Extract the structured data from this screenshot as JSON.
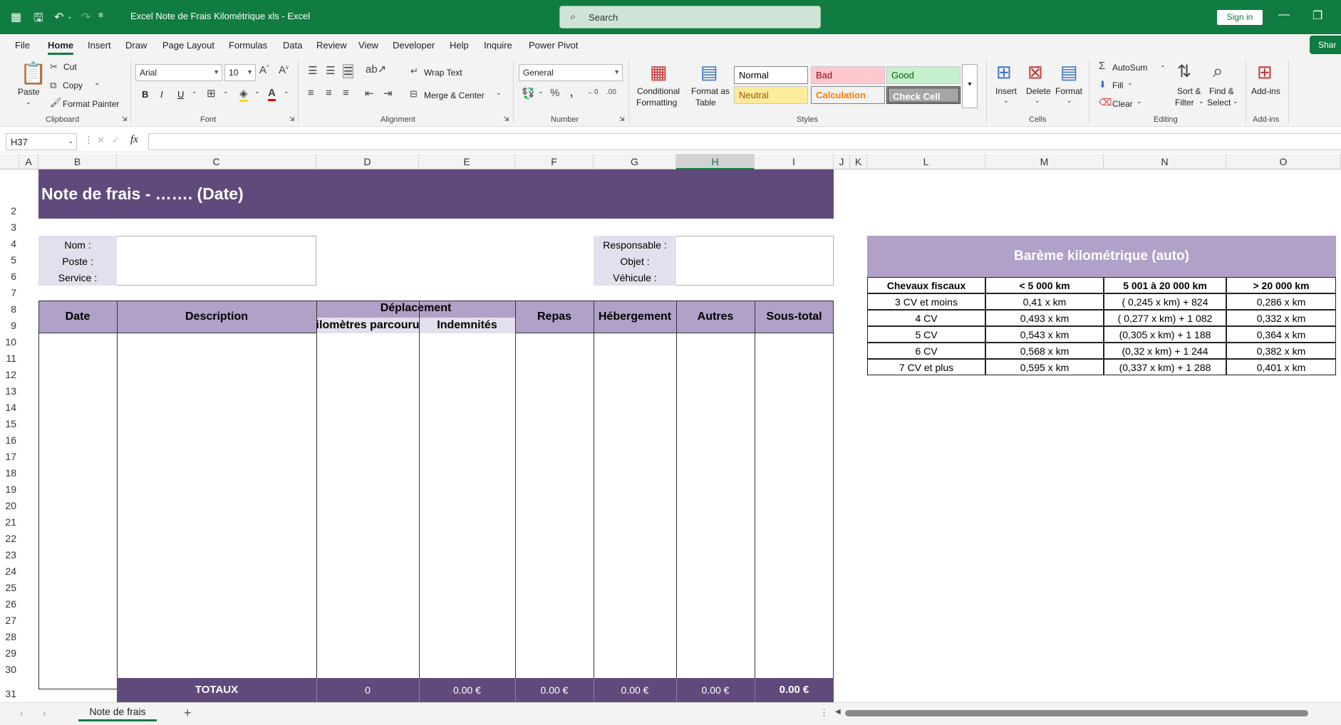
{
  "titlebar": {
    "doc_title": "Excel Note de Frais Kilométrique xls  -  Excel",
    "search": "Search",
    "signin": "Sign in"
  },
  "menu": {
    "tabs": [
      "File",
      "Home",
      "Insert",
      "Draw",
      "Page Layout",
      "Formulas",
      "Data",
      "Review",
      "View",
      "Developer",
      "Help",
      "Inquire",
      "Power Pivot"
    ],
    "share": "Shar"
  },
  "ribbon": {
    "clipboard": {
      "paste": "Paste",
      "cut": "Cut",
      "copy": "Copy",
      "format_painter": "Format Painter",
      "label": "Clipboard"
    },
    "font": {
      "name": "Arial",
      "size": "10",
      "bold": "B",
      "italic": "I",
      "underline": "U",
      "label": "Font"
    },
    "alignment": {
      "wrap": "Wrap Text",
      "merge": "Merge & Center",
      "label": "Alignment"
    },
    "number": {
      "format": "General",
      "label": "Number"
    },
    "styles": {
      "conditional1": "Conditional",
      "conditional2": "Formatting",
      "format_table1": "Format as",
      "format_table2": "Table",
      "normal": "Normal",
      "bad": "Bad",
      "good": "Good",
      "neutral": "Neutral",
      "calculation": "Calculation",
      "check_cell": "Check Cell",
      "label": "Styles"
    },
    "cells": {
      "insert": "Insert",
      "delete": "Delete",
      "format": "Format",
      "label": "Cells"
    },
    "editing": {
      "autosum": "AutoSum",
      "fill": "Fill",
      "clear": "Clear",
      "sort1": "Sort &",
      "sort2": "Filter",
      "find1": "Find &",
      "find2": "Select",
      "label": "Editing"
    },
    "addins": {
      "addins": "Add-ins",
      "label": "Add-ins"
    }
  },
  "formula_bar": {
    "namebox": "H37",
    "fx": "fx",
    "value": ""
  },
  "columns": [
    "A",
    "B",
    "C",
    "D",
    "E",
    "F",
    "G",
    "H",
    "I",
    "J",
    "K",
    "L",
    "M",
    "N",
    "O"
  ],
  "rows": [
    "2",
    "3",
    "4",
    "5",
    "6",
    "7",
    "8",
    "9",
    "10",
    "11",
    "12",
    "13",
    "14",
    "15",
    "16",
    "17",
    "18",
    "19",
    "20",
    "21",
    "22",
    "23",
    "24",
    "25",
    "26",
    "27",
    "28",
    "29",
    "30",
    "31"
  ],
  "sheet": {
    "title": "Note de frais - …….  (Date)",
    "info_left": [
      "Nom :",
      "Poste :",
      "Service :"
    ],
    "info_right": [
      "Responsable :",
      "Objet :",
      "Véhicule :"
    ],
    "headers": {
      "date": "Date",
      "description": "Description",
      "deplacement": "Déplacement",
      "km": "Kilomètres parcourus",
      "indemnites": "Indemnités",
      "repas": "Repas",
      "hebergement": "Hébergement",
      "autres": "Autres",
      "sous_total": "Sous-total"
    },
    "totals": {
      "label": "TOTAUX",
      "km": "0",
      "indemnites": "0.00 €",
      "repas": "0.00 €",
      "hebergement": "0.00 €",
      "autres": "0.00 €",
      "sous_total": "0.00 €"
    }
  },
  "bareme": {
    "title": "Barème kilométrique (auto)",
    "headers": [
      "Chevaux fiscaux",
      "< 5 000 km",
      "5 001 à 20 000 km",
      "> 20 000 km"
    ],
    "rows": [
      [
        "3 CV et moins",
        "0,41 x km",
        "( 0,245 x km) + 824",
        "0,286 x km"
      ],
      [
        "4 CV",
        "0,493 x km",
        "( 0,277 x km) + 1 082",
        "0,332 x km"
      ],
      [
        "5 CV",
        "0,543 x km",
        "(0,305 x km) + 1 188",
        "0,364 x km"
      ],
      [
        "6 CV",
        "0,568 x km",
        "(0,32 x km) + 1 244",
        "0,382 x km"
      ],
      [
        "7 CV et plus",
        "0,595 x km",
        "(0,337 x km) + 1 288",
        "0,401 x km"
      ]
    ]
  },
  "tabs": {
    "sheet": "Note de frais"
  },
  "colors": {
    "excel_green": "#107c41",
    "header_dark": "#604a7b",
    "header_light": "#b1a0c7"
  }
}
